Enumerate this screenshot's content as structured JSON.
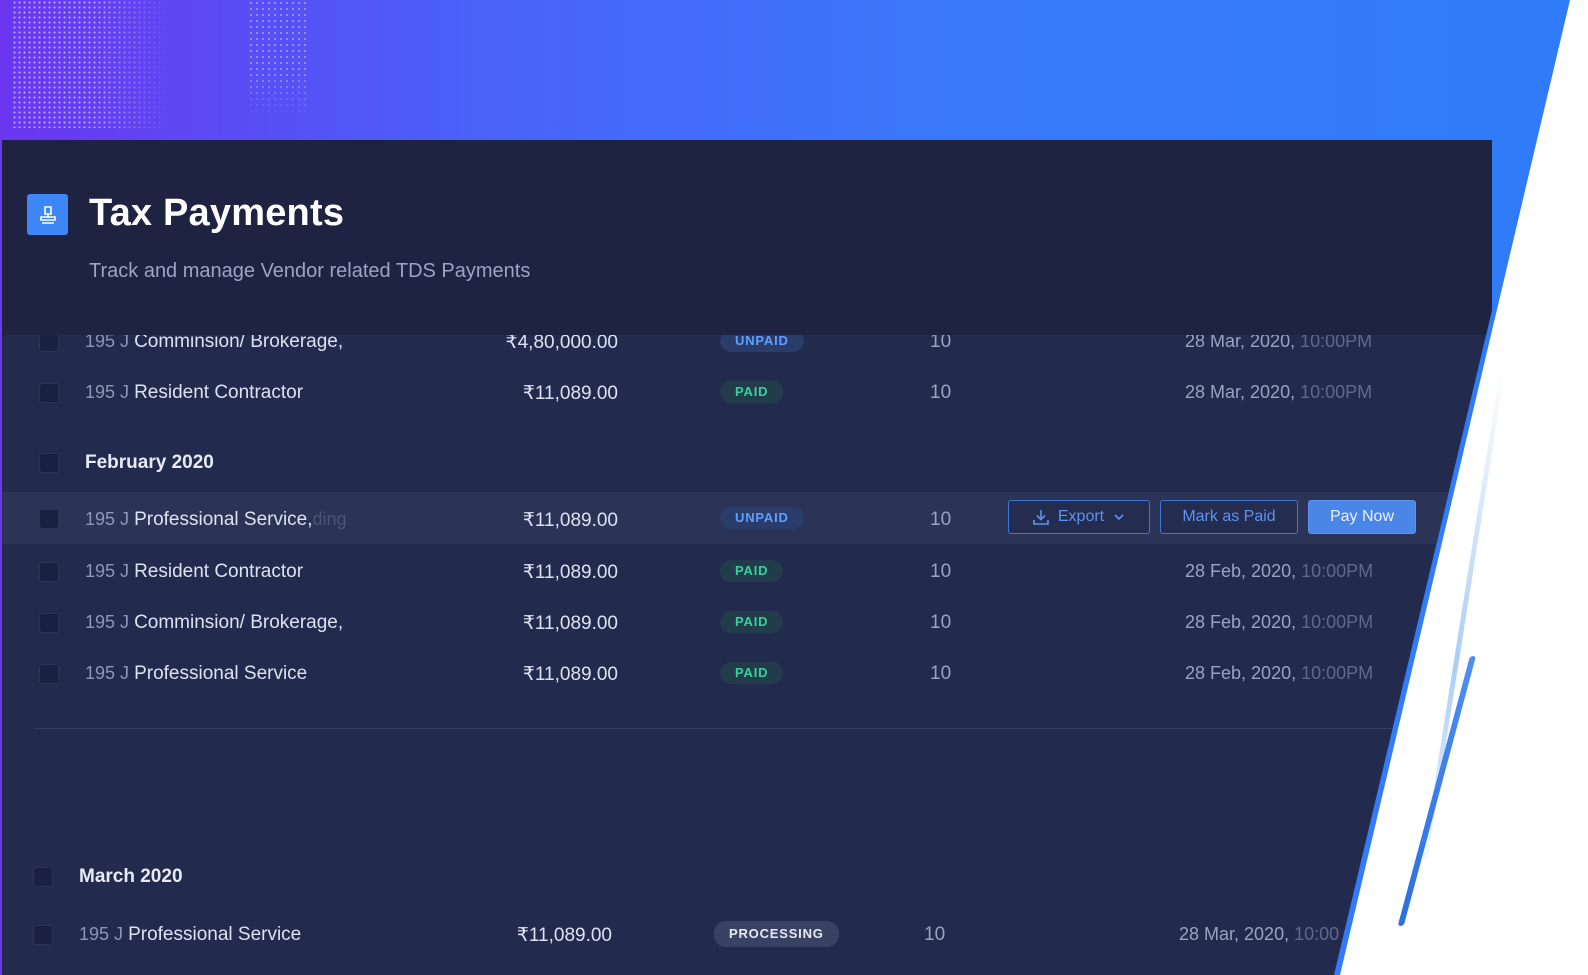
{
  "header": {
    "title": "Tax Payments",
    "subtitle": "Track and manage Vendor related TDS Payments"
  },
  "actions": {
    "export_label": "Export",
    "mark_paid_label": "Mark as Paid",
    "pay_now_label": "Pay Now"
  },
  "rows_top": [
    {
      "code": "195 J",
      "service": "Comminsion/ Brokerage,",
      "amount": "₹4,80,000.00",
      "status": "UNPAID",
      "qty": "10",
      "date": "28 Mar, 2020,",
      "time": "10:00PM"
    },
    {
      "code": "195 J",
      "service": "Resident Contractor",
      "amount": "₹11,089.00",
      "status": "PAID",
      "qty": "10",
      "date": "28 Mar, 2020,",
      "time": "10:00PM"
    }
  ],
  "groups": [
    {
      "title": "February 2020",
      "rows": [
        {
          "code": "195 J",
          "service": "Professional Service,",
          "service_ghost": "ding",
          "amount": "₹11,089.00",
          "status": "UNPAID",
          "qty": "10",
          "hovered": true
        },
        {
          "code": "195 J",
          "service": "Resident Contractor",
          "amount": "₹11,089.00",
          "status": "PAID",
          "qty": "10",
          "date": "28 Feb, 2020,",
          "time": "10:00PM"
        },
        {
          "code": "195 J",
          "service": "Comminsion/ Brokerage,",
          "amount": "₹11,089.00",
          "status": "PAID",
          "qty": "10",
          "date": "28 Feb, 2020,",
          "time": "10:00PM"
        },
        {
          "code": "195 J",
          "service": "Professional Service",
          "amount": "₹11,089.00",
          "status": "PAID",
          "qty": "10",
          "date": "28 Feb, 2020,",
          "time": "10:00PM"
        }
      ]
    },
    {
      "title": "March 2020",
      "rows": [
        {
          "code": "195 J",
          "service": "Professional Service",
          "amount": "₹11,089.00",
          "status": "PROCESSING",
          "qty": "10",
          "date": "28 Mar, 2020,",
          "time": "10:00"
        }
      ]
    }
  ],
  "colors": {
    "accent": "#3d86f5",
    "paid": "#33d29a",
    "unpaid": "#5ea0ff",
    "panel": "#222a4d"
  },
  "icons": {
    "app": "stamp-icon",
    "export": "download-icon",
    "export_caret": "chevron-down-icon"
  }
}
